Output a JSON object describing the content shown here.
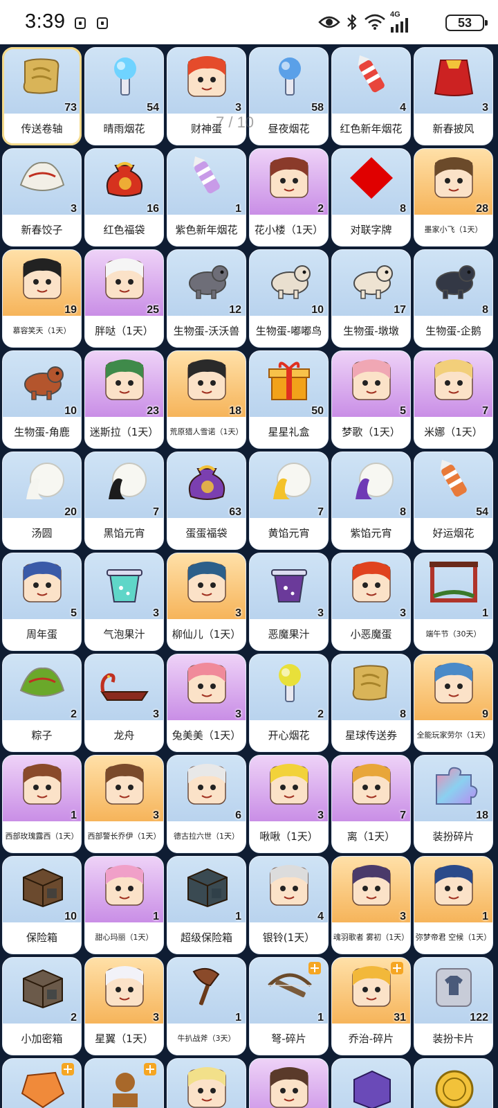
{
  "status_bar": {
    "time": "3:39",
    "network": "4G",
    "battery": "53"
  },
  "page_indicator": "7 / 10",
  "items": [
    {
      "name": "传送卷轴",
      "count": "73",
      "style": "blue",
      "art": "scroll",
      "color": "#d9b458"
    },
    {
      "name": "晴雨烟花",
      "count": "54",
      "style": "blue",
      "art": "firework",
      "color": "#6fd3ff"
    },
    {
      "name": "财神蛋",
      "count": "3",
      "style": "blue",
      "art": "face",
      "color": "#e54b2b"
    },
    {
      "name": "昼夜烟花",
      "count": "58",
      "style": "blue",
      "art": "firework",
      "color": "#5aa0e8"
    },
    {
      "name": "红色新年烟花",
      "count": "4",
      "style": "blue",
      "art": "rocket",
      "color": "#e8453c"
    },
    {
      "name": "新春披风",
      "count": "3",
      "style": "blue",
      "art": "cape",
      "color": "#cc2222"
    },
    {
      "name": "新春饺子",
      "count": "3",
      "style": "blue",
      "art": "dumpling",
      "color": "#f2efe6"
    },
    {
      "name": "红色福袋",
      "count": "16",
      "style": "blue",
      "art": "bag",
      "color": "#d6321e"
    },
    {
      "name": "紫色新年烟花",
      "count": "1",
      "style": "blue",
      "art": "rocket",
      "color": "#c89be8"
    },
    {
      "name": "花小楼（1天）",
      "count": "2",
      "style": "purple",
      "art": "face",
      "color": "#8a3a2a"
    },
    {
      "name": "对联字牌",
      "count": "8",
      "style": "blue",
      "art": "diamond",
      "color": "#e00000"
    },
    {
      "name": "墨家小飞（1天）",
      "count": "28",
      "style": "orange",
      "art": "face",
      "color": "#6b4a2a"
    },
    {
      "name": "慕容笑天（1天）",
      "count": "19",
      "style": "orange",
      "art": "face",
      "color": "#222222"
    },
    {
      "name": "胖哒（1天）",
      "count": "25",
      "style": "purple",
      "art": "face",
      "color": "#f5f5f5"
    },
    {
      "name": "生物蛋-沃沃兽",
      "count": "12",
      "style": "blue",
      "art": "animal",
      "color": "#6e6e78"
    },
    {
      "name": "生物蛋-嘟嘟鸟",
      "count": "10",
      "style": "blue",
      "art": "animal",
      "color": "#e9dfcf"
    },
    {
      "name": "生物蛋-墩墩",
      "count": "17",
      "style": "blue",
      "art": "animal",
      "color": "#eee3d2"
    },
    {
      "name": "生物蛋-企鹅",
      "count": "8",
      "style": "blue",
      "art": "animal",
      "color": "#333845"
    },
    {
      "name": "生物蛋-角鹿",
      "count": "10",
      "style": "blue",
      "art": "animal",
      "color": "#b4552d"
    },
    {
      "name": "迷斯拉（1天）",
      "count": "23",
      "style": "purple",
      "art": "face",
      "color": "#3f8a4a"
    },
    {
      "name": "荒原猎人雪诺（1天）",
      "count": "18",
      "style": "orange",
      "art": "face",
      "color": "#2a2a2a"
    },
    {
      "name": "星星礼盒",
      "count": "50",
      "style": "blue",
      "art": "gift",
      "color": "#f2a21a"
    },
    {
      "name": "梦歌（1天）",
      "count": "5",
      "style": "purple",
      "art": "face",
      "color": "#f0a7b4"
    },
    {
      "name": "米娜（1天）",
      "count": "7",
      "style": "purple",
      "art": "face",
      "color": "#f2cf7a"
    },
    {
      "name": "汤圆",
      "count": "20",
      "style": "blue",
      "art": "ball",
      "color": "#f5f5f0"
    },
    {
      "name": "黑馅元宵",
      "count": "7",
      "style": "blue",
      "art": "ball",
      "color": "#1c1c1c"
    },
    {
      "name": "蛋蛋福袋",
      "count": "63",
      "style": "blue",
      "art": "bag",
      "color": "#7b3fb0"
    },
    {
      "name": "黄馅元宵",
      "count": "7",
      "style": "blue",
      "art": "ball",
      "color": "#f4c22a"
    },
    {
      "name": "紫馅元宵",
      "count": "8",
      "style": "blue",
      "art": "ball",
      "color": "#6f3ab5"
    },
    {
      "name": "好运烟花",
      "count": "54",
      "style": "blue",
      "art": "rocket",
      "color": "#e87a3a"
    },
    {
      "name": "周年蛋",
      "count": "5",
      "style": "blue",
      "art": "face",
      "color": "#3a5aa8"
    },
    {
      "name": "气泡果汁",
      "count": "3",
      "style": "blue",
      "art": "drink",
      "color": "#5fd6c8"
    },
    {
      "name": "柳仙儿（1天）",
      "count": "3",
      "style": "orange",
      "art": "face",
      "color": "#2c5f8a"
    },
    {
      "name": "恶魔果汁",
      "count": "3",
      "style": "blue",
      "art": "drink",
      "color": "#6b3a9a"
    },
    {
      "name": "小恶魔蛋",
      "count": "3",
      "style": "blue",
      "art": "face",
      "color": "#e0421e"
    },
    {
      "name": "端午节（30天）",
      "count": "1",
      "style": "blue",
      "art": "frame",
      "color": "#b0342a"
    },
    {
      "name": "粽子",
      "count": "2",
      "style": "blue",
      "art": "dumpling",
      "color": "#6aa82a"
    },
    {
      "name": "龙舟",
      "count": "3",
      "style": "blue",
      "art": "boat",
      "color": "#8a2a1e"
    },
    {
      "name": "兔美美（1天）",
      "count": "3",
      "style": "purple",
      "art": "face",
      "color": "#f08a9a"
    },
    {
      "name": "开心烟花",
      "count": "2",
      "style": "blue",
      "art": "firework",
      "color": "#e8e03a"
    },
    {
      "name": "星球传送券",
      "count": "8",
      "style": "blue",
      "art": "scroll",
      "color": "#d9b458"
    },
    {
      "name": "全能玩家劳尔（1天）",
      "count": "9",
      "style": "orange",
      "art": "face",
      "color": "#4a8ac8"
    },
    {
      "name": "西部玫瑰露西（1天）",
      "count": "1",
      "style": "purple",
      "art": "face",
      "color": "#8a4a2a"
    },
    {
      "name": "西部警长乔伊（1天）",
      "count": "3",
      "style": "orange",
      "art": "face",
      "color": "#7a4a2a"
    },
    {
      "name": "德古拉六世（1天）",
      "count": "6",
      "style": "blue",
      "art": "face",
      "color": "#e8e8e8"
    },
    {
      "name": "啾啾（1天）",
      "count": "3",
      "style": "purple",
      "art": "face",
      "color": "#f2d23a"
    },
    {
      "name": "离（1天）",
      "count": "7",
      "style": "purple",
      "art": "face",
      "color": "#e8a63a"
    },
    {
      "name": "装扮碎片",
      "count": "18",
      "style": "blue",
      "art": "puzzle",
      "color": "#6ac0f0"
    },
    {
      "name": "保险箱",
      "count": "10",
      "style": "blue",
      "art": "box",
      "color": "#6b4a2e"
    },
    {
      "name": "甜心玛丽（1天）",
      "count": "1",
      "style": "purple",
      "art": "face",
      "color": "#f0a0c8"
    },
    {
      "name": "超级保险箱",
      "count": "1",
      "style": "blue",
      "art": "box",
      "color": "#3a4a52"
    },
    {
      "name": "银铃(1天）",
      "count": "4",
      "style": "blue",
      "art": "face",
      "color": "#dcdcdc"
    },
    {
      "name": "魂羽歌者 雾初（1天）",
      "count": "3",
      "style": "orange",
      "art": "face",
      "color": "#4a3a6a"
    },
    {
      "name": "弥梦帝君 空候（1天）",
      "count": "1",
      "style": "orange",
      "art": "face",
      "color": "#2a4a8a"
    },
    {
      "name": "小加密箱",
      "count": "2",
      "style": "blue",
      "art": "box",
      "color": "#6b5a4a"
    },
    {
      "name": "星翼（1天）",
      "count": "3",
      "style": "orange",
      "art": "face",
      "color": "#f2f2f8"
    },
    {
      "name": "牛扒战斧（3天）",
      "count": "1",
      "style": "blue",
      "art": "axe",
      "color": "#8a4a2a"
    },
    {
      "name": "弩-碎片",
      "count": "1",
      "style": "blue",
      "art": "crossbow",
      "color": "#7a5a3a",
      "badge": true
    },
    {
      "name": "乔治-碎片",
      "count": "31",
      "style": "orange",
      "art": "face",
      "color": "#f2b83a",
      "badge": true
    },
    {
      "name": "装扮卡片",
      "count": "122",
      "style": "blue",
      "art": "shirt",
      "color": "#c8ccd8"
    },
    {
      "name": "",
      "count": "",
      "style": "blue",
      "art": "gem",
      "color": "#f08a3a",
      "badge": true
    },
    {
      "name": "",
      "count": "",
      "style": "blue",
      "art": "statue",
      "color": "#a8682a",
      "badge": true
    },
    {
      "name": "",
      "count": "",
      "style": "blue",
      "art": "face",
      "color": "#f2e08a"
    },
    {
      "name": "",
      "count": "",
      "style": "purple",
      "art": "face",
      "color": "#5a3a2a"
    },
    {
      "name": "",
      "count": "",
      "style": "blue",
      "art": "cube",
      "color": "#6a4ab8"
    },
    {
      "name": "",
      "count": "",
      "style": "blue",
      "art": "coin",
      "color": "#f2c23a"
    }
  ]
}
